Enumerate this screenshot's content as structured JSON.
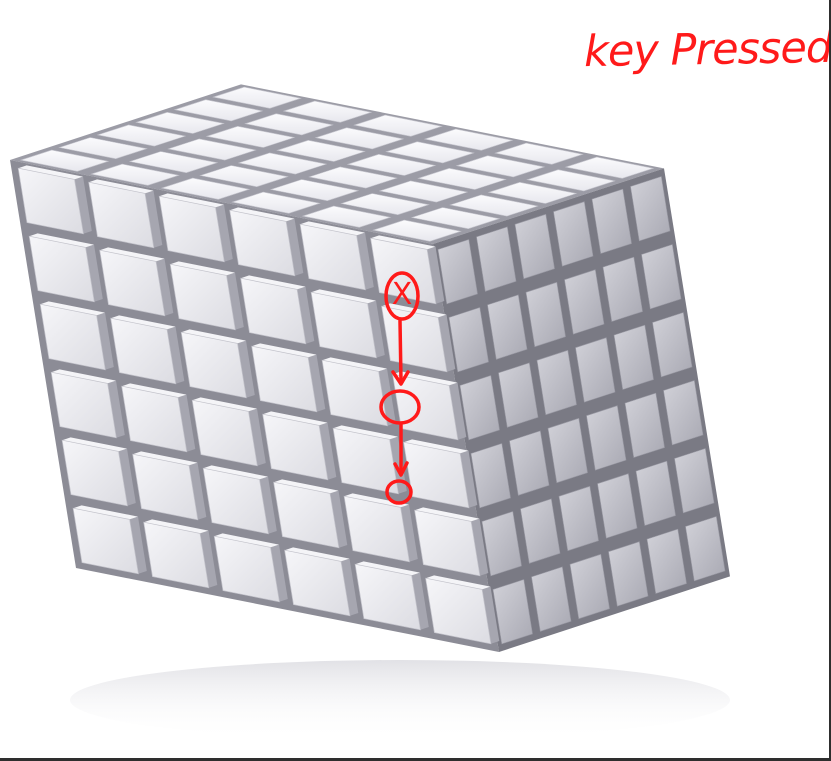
{
  "annotation": {
    "label": "key Pressed",
    "pressed_marker": "X",
    "color": "#ff1a1a"
  },
  "cube": {
    "grid": "6x6x6",
    "face_color": "#ececf0"
  }
}
